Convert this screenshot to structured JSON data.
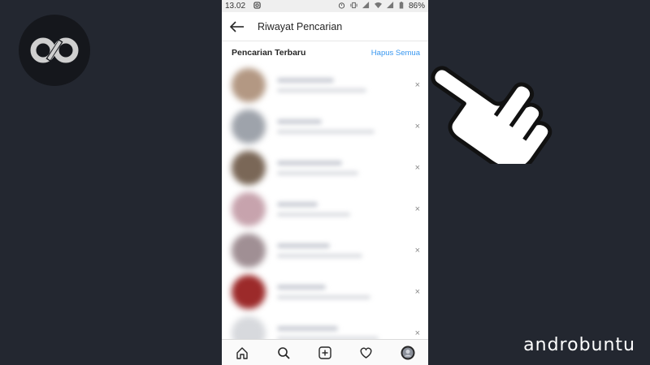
{
  "status_bar": {
    "time": "13.02",
    "battery": "86%"
  },
  "app_bar": {
    "back_icon": "arrow-left-icon",
    "title": "Riwayat Pencarian"
  },
  "section": {
    "heading": "Pencarian Terbaru",
    "clear_all": "Hapus Semua"
  },
  "history_items": [
    {
      "remove_label": "×",
      "avatar_color": "#b39883"
    },
    {
      "remove_label": "×",
      "avatar_color": "#9ea3ab"
    },
    {
      "remove_label": "×",
      "avatar_color": "#7a6757"
    },
    {
      "remove_label": "×",
      "avatar_color": "#c7a3ad"
    },
    {
      "remove_label": "×",
      "avatar_color": "#a08f94"
    },
    {
      "remove_label": "×",
      "avatar_color": "#9c2a2a"
    },
    {
      "remove_label": "×",
      "avatar_color": "#d7d9dd"
    }
  ],
  "bottom_nav": [
    "home-icon",
    "search-icon",
    "add-post-icon",
    "heart-icon",
    "profile-avatar"
  ],
  "watermark": {
    "brand": "androbuntu",
    "logo": "androbuntu-logo-icon"
  },
  "overlay": {
    "pointer": "pointing-hand-icon"
  },
  "colors": {
    "background": "#232730",
    "link_blue": "#3897f0"
  }
}
